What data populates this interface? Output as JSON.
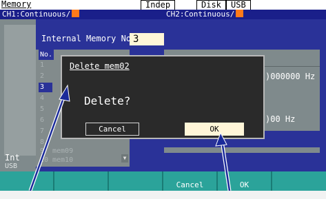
{
  "topbar": {
    "title": "Memory",
    "mode": "Indep",
    "disk": "Disk",
    "usb": "USB",
    "ch1": "CH1:Continuous/",
    "ch2": "CH2:Continuous/"
  },
  "main": {
    "header_label": "Internal Memory No.",
    "memory_number": "3",
    "list_header": "No.",
    "selected_index": "3",
    "list_items": [
      {
        "num": "1",
        "name": ""
      },
      {
        "num": "2",
        "name": ""
      },
      {
        "num": "3",
        "name": ""
      },
      {
        "num": "4",
        "name": ""
      },
      {
        "num": "5",
        "name": ""
      },
      {
        "num": "6",
        "name": ""
      },
      {
        "num": "7",
        "name": ""
      },
      {
        "num": "8",
        "name": ""
      },
      {
        "num": "9",
        "name": "mem09"
      },
      {
        "num": "10",
        "name": "mem10"
      }
    ],
    "freq1_tail": ")000000 Hz",
    "freq2_tail": ")00 Hz",
    "side_label_int": "Int",
    "side_label_usb": "USB"
  },
  "dialog": {
    "title": "Delete mem02",
    "message": "Delete?",
    "cancel_label": "Cancel",
    "ok_label": "OK"
  },
  "softkeys": [
    "",
    "",
    "",
    "Cancel",
    "OK",
    ""
  ],
  "colors": {
    "screen_blue": "#2a3298",
    "dialog_bg": "#2a2a2a",
    "highlight": "#fff6d8",
    "softkey": "#2ba39a",
    "indicator": "#ff7a1a"
  }
}
